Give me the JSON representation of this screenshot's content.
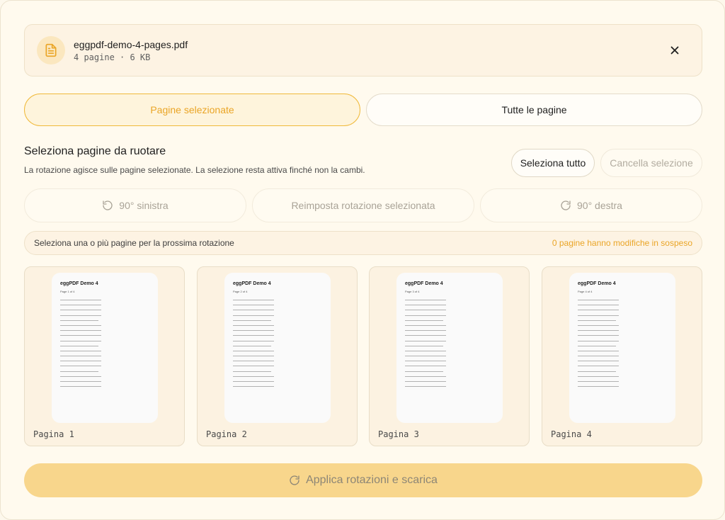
{
  "file": {
    "name": "eggpdf-demo-4-pages.pdf",
    "meta": "4 pagine · 6 KB",
    "icon": "file-text-icon",
    "close_icon": "close-icon"
  },
  "mode": {
    "selected_label": "Pagine selezionate",
    "all_label": "Tutte le pagine",
    "active": "selected"
  },
  "section": {
    "title": "Seleziona pagine da ruotare",
    "description": "La rotazione agisce sulle pagine selezionate. La selezione resta attiva finché non la cambi.",
    "select_all_label": "Seleziona tutto",
    "clear_selection_label": "Cancella selezione"
  },
  "rotation": {
    "left_label": "90° sinistra",
    "reset_label": "Reimposta rotazione selezionata",
    "right_label": "90° destra"
  },
  "status": {
    "hint": "Seleziona una o più pagine per la prossima rotazione",
    "pending": "0 pagine hanno modifiche in sospeso"
  },
  "pages": [
    {
      "label": "Pagina 1",
      "thumb_title": "eggPDF Demo 4",
      "thumb_sub": "Page 1 of 4"
    },
    {
      "label": "Pagina 2",
      "thumb_title": "eggPDF Demo 4",
      "thumb_sub": "Page 2 of 4"
    },
    {
      "label": "Pagina 3",
      "thumb_title": "eggPDF Demo 4",
      "thumb_sub": "Page 3 of 4"
    },
    {
      "label": "Pagina 4",
      "thumb_title": "eggPDF Demo 4",
      "thumb_sub": "Page 4 of 4"
    }
  ],
  "apply": {
    "label": "Applica rotazioni e scarica"
  },
  "colors": {
    "accent": "#eaa526",
    "apply_bg": "#f8d68c",
    "background": "#fffaee"
  }
}
